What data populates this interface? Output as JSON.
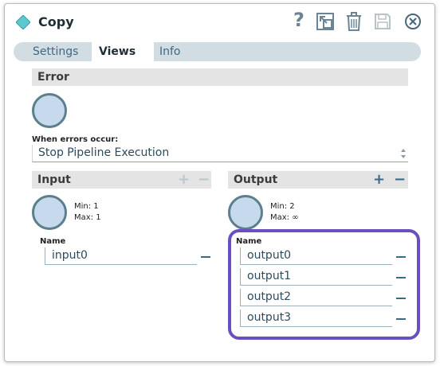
{
  "dialog": {
    "title": "Copy",
    "icon": "diamond-icon",
    "header_buttons": [
      "help-icon",
      "expand-icon",
      "trash-icon",
      "save-icon",
      "close-icon"
    ],
    "help_label": "?"
  },
  "tabs": [
    {
      "label": "Settings",
      "active": false
    },
    {
      "label": "Views",
      "active": true
    },
    {
      "label": "Info",
      "active": false
    }
  ],
  "error": {
    "heading": "Error",
    "when_label": "When errors occur:",
    "selected_option": "Stop Pipeline Execution"
  },
  "input": {
    "heading": "Input",
    "min_label": "Min: 1",
    "max_label": "Max: 1",
    "name_header": "Name",
    "views": [
      "input0"
    ]
  },
  "output": {
    "heading": "Output",
    "min_label": "Min: 2",
    "max_label": "Max: ∞",
    "name_header": "Name",
    "views": [
      "output0",
      "output1",
      "output2",
      "output3"
    ]
  },
  "colors": {
    "accent": "#3a6a87",
    "highlight": "#6a4fc2",
    "circle_fill": "#c7d9ec",
    "diamond": "#5cc8d0"
  }
}
